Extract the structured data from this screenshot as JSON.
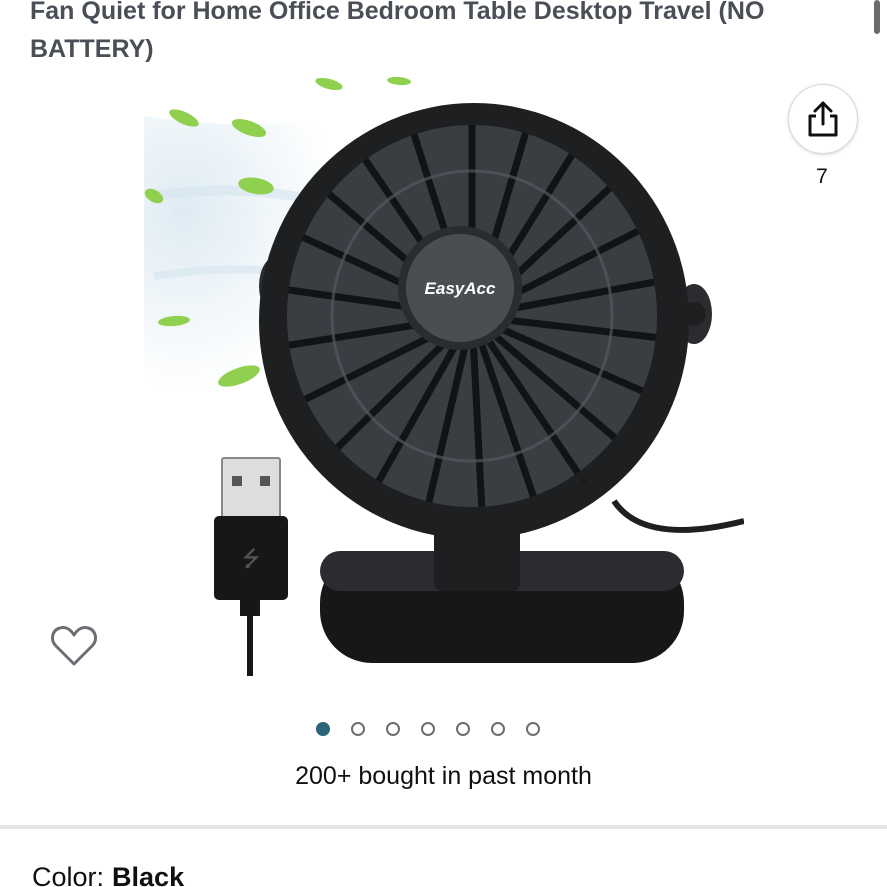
{
  "product": {
    "title": "Fan Quiet for Home Office Bedroom Table Desktop Travel (NO BATTERY)",
    "image_alt": "EasyAcc desk fan with USB cable",
    "brand_on_image": "EasyAcc"
  },
  "share": {
    "icon": "share-icon",
    "count": "7"
  },
  "wishlist": {
    "icon": "heart-icon"
  },
  "gallery": {
    "image_count": 7,
    "active_index": 0
  },
  "social_proof": {
    "text": "200+ bought in past month"
  },
  "variation": {
    "label": "Color:",
    "value": "Black"
  },
  "colors": {
    "active_dot": "#2b6477",
    "inactive_dot_border": "#6b6f74",
    "divider": "#e3e6e6",
    "fan_body": "#1e1f21",
    "leaf": "#8fd14f"
  }
}
